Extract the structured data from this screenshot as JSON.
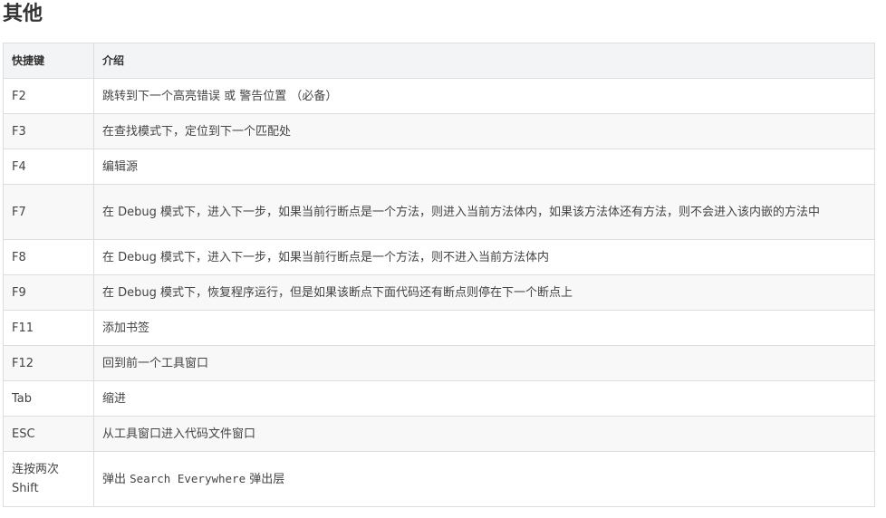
{
  "heading": "其他",
  "table": {
    "headers": {
      "key": "快捷键",
      "desc": "介绍"
    },
    "rows": [
      {
        "key": "F2",
        "desc": "跳转到下一个高亮错误 或 警告位置 （必备）"
      },
      {
        "key": "F3",
        "desc": "在查找模式下，定位到下一个匹配处"
      },
      {
        "key": "F4",
        "desc": "编辑源"
      },
      {
        "key": "F7",
        "desc": "在 Debug 模式下，进入下一步，如果当前行断点是一个方法，则进入当前方法体内，如果该方法体还有方法，则不会进入该内嵌的方法中"
      },
      {
        "key": "F8",
        "desc": "在 Debug 模式下，进入下一步，如果当前行断点是一个方法，则不进入当前方法体内"
      },
      {
        "key": "F9",
        "desc": "在 Debug 模式下，恢复程序运行，但是如果该断点下面代码还有断点则停在下一个断点上"
      },
      {
        "key": "F11",
        "desc": "添加书签"
      },
      {
        "key": "F12",
        "desc": "回到前一个工具窗口"
      },
      {
        "key": "Tab",
        "desc": "缩进"
      },
      {
        "key": "ESC",
        "desc": "从工具窗口进入代码文件窗口"
      }
    ],
    "last_row": {
      "key": "连按两次 Shift",
      "desc_prefix": "弹出",
      "desc_code": "Search Everywhere",
      "desc_suffix": "弹出层"
    }
  }
}
